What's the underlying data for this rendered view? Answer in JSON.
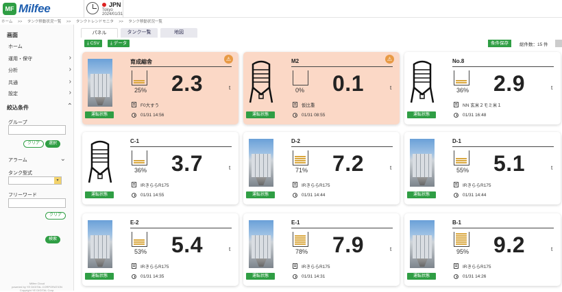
{
  "app": {
    "logo_mark": "MF",
    "name": "Milfee"
  },
  "region": {
    "country": "JPN",
    "city": "Tokyo",
    "date": "2024/01/31"
  },
  "breadcrumbs": [
    "ホーム",
    ">>",
    "タンク移動状況一覧",
    ">>",
    "タンクトレンドモニタ",
    ">>",
    "タンク移動状況一覧"
  ],
  "sidebar": {
    "section_title": "画面",
    "menu": [
      "ホーム",
      "運用・保守",
      "分析",
      "共通",
      "設定"
    ],
    "filter_title": "絞込条件",
    "group_label": "グループ",
    "clear_label": "クリア",
    "select_label": "選択",
    "alarm_label": "アラーム",
    "tank_type_label": "タンク型式",
    "freeword_label": "フリーワード",
    "clear2_label": "クリア",
    "search_label": "検索",
    "footer": [
      "Milfee Cloud",
      "powered by YE DIGITAL CORPORATION",
      "Copyright YE DIGITAL Corp."
    ]
  },
  "tabs": [
    "パネル",
    "タンク一覧",
    "地図"
  ],
  "toolbar": {
    "csv": "CSV",
    "data": "データ",
    "save": "条件保存",
    "count": "総件数：15 件"
  },
  "status_label": "運転状態",
  "unit": "t",
  "colors": {
    "accent": "#2f9e44",
    "alert_bg": "#fbd8c6",
    "level": "#d9a63c"
  },
  "cards": [
    {
      "name": "育成縮舎",
      "value": "2.3",
      "percent": "25%",
      "level": 0.25,
      "feed": "F0大すう",
      "time": "01/31 14:56",
      "alert": true,
      "image": "photo",
      "micro": ""
    },
    {
      "name": "M2",
      "value": "0.1",
      "percent": "0%",
      "level": 0.0,
      "feed": "仮比重",
      "time": "01/31 08:55",
      "alert": true,
      "image": "icon",
      "micro": ""
    },
    {
      "name": "No.8",
      "value": "2.9",
      "percent": "36%",
      "level": 0.36,
      "feed": "NN 玄米２モミ米１",
      "time": "01/31 16:48",
      "alert": false,
      "image": "icon",
      "micro": ""
    },
    {
      "name": "C-1",
      "value": "3.7",
      "percent": "36%",
      "level": 0.36,
      "feed": "IRきららR175",
      "time": "01/31 14:55",
      "alert": false,
      "image": "icon",
      "micro": ""
    },
    {
      "name": "D-2",
      "value": "7.2",
      "percent": "71%",
      "level": 0.71,
      "feed": "IRきららR175",
      "time": "01/31 14:44",
      "alert": false,
      "image": "photo",
      "micro": ""
    },
    {
      "name": "D-1",
      "value": "5.1",
      "percent": "55%",
      "level": 0.55,
      "feed": "IRきららR175",
      "time": "01/31 14:44",
      "alert": false,
      "image": "photo",
      "micro": ""
    },
    {
      "name": "E-2",
      "value": "5.4",
      "percent": "53%",
      "level": 0.53,
      "feed": "IRきららR175",
      "time": "01/31 14:35",
      "alert": false,
      "image": "photo",
      "micro": ""
    },
    {
      "name": "E-1",
      "value": "7.9",
      "percent": "78%",
      "level": 0.78,
      "feed": "IRきららR175",
      "time": "01/31 14:31",
      "alert": false,
      "image": "photo",
      "micro": ""
    },
    {
      "name": "B-1",
      "value": "9.2",
      "percent": "95%",
      "level": 0.95,
      "feed": "IRきららR175",
      "time": "01/31 14:26",
      "alert": false,
      "image": "photo",
      "micro": ""
    }
  ]
}
